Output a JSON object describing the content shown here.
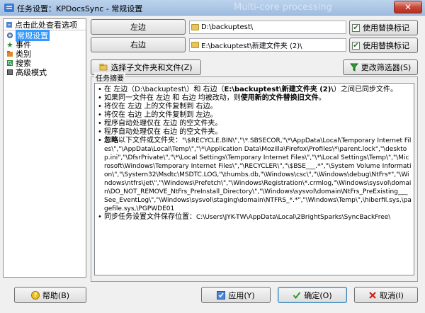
{
  "window": {
    "title": "任务设置：KPDocsSync - 常规设置",
    "background_title": "Multi-core processing",
    "close_label": "✕"
  },
  "sidebar": {
    "header": "点击此处查看选项",
    "items": [
      {
        "label": "常规设置",
        "icon": "gear-icon",
        "selected": true
      },
      {
        "label": "事件",
        "icon": "event-icon",
        "selected": false
      },
      {
        "label": "类别",
        "icon": "category-icon",
        "selected": false
      },
      {
        "label": "搜索",
        "icon": "search-icon",
        "selected": false
      },
      {
        "label": "高级模式",
        "icon": "advanced-icon",
        "selected": false
      }
    ]
  },
  "left": {
    "button": "左边",
    "path": "D:\\backuptest\\",
    "alt_label": "使用替换标记"
  },
  "right": {
    "button": "右边",
    "path": "E:\\backuptest\\新建文件夹 (2)\\",
    "alt_label": "使用替换标记"
  },
  "toolbar": {
    "subfolders_label": "选择子文件夹和文件(Z)",
    "filters_label": "更改筛选器(S)"
  },
  "summary": {
    "title": "任务摘要",
    "lines": {
      "l1a": "在 左边（D:\\backuptest\\）和 右边（",
      "l1b": "E:\\backuptest\\新建文件夹 (2)\\",
      "l1c": "）之间已同步文件。",
      "l2a": "如果同一文件在 左边 和 右边 均被改动，则",
      "l2b": "使用新的文件替换旧文件",
      "l2c": "。",
      "l3": "将仅在 左边 上的文件复制到 右边。",
      "l4": "将仅在 右边 上的文件复制到 左边。",
      "l5": "程序自动处理仅在 左边 的空文件夹。",
      "l6": "程序自动处理仅在 右边 的空文件夹。",
      "l7a": "忽略",
      "l7b": "以下文件或文件夹：",
      "l7c": "\"\\$RECYCLE.BIN\\\",\"\\*.SBSECOR,\"\\*\\AppData\\Local\\Temporary Internet Files\\\",\"\\AppData\\Local\\Temp\\\",\"\\*\\Application Data\\Mozilla\\Firefox\\Profiles\\*\\parent.lock\",\"\\desktop.ini\",\"\\DfsrPrivate\\\",\"\\*\\Local Settings\\Temporary Internet Files\\\",\"\\*\\Local Settings\\Temp\\\",\"\\Microsoft\\Windows\\Temporary Internet Files\\\",\"\\RECYCLER\\\",\"\\$BSE___.*\",\"\\System Volume Information\\\",\"\\System32\\Msdtc\\MSDTC.LOG,\"\\thumbs.db,\"\\Windows\\csc\\\",\"\\Windows\\debug\\NtFrs*\",\"\\Windows\\ntfrs\\jet\\\",\"\\Windows\\Prefetch\\\",\"\\Windows\\Registration\\*.crmlog,\"\\Windows\\sysvol\\domain\\DO_NOT_REMOVE_NtFrs_PreInstall_Directory\\\",\"\\Windows\\sysvol\\domain\\NtFrs_PreExisting___See_EventLog\\\",\"\\Windows\\sysvol\\staging\\domain\\NTFRS_*.*\",\"\\Windows\\Temp\\\",\\hiberfil.sys,\\pagefile.sys,\\PGPWDE01",
      "l8a": "同步任务设置文件保存位置：",
      "l8b": "C:\\Users\\JYK-TW\\AppData\\Local\\2BrightSparks\\SyncBackFree\\"
    }
  },
  "footer": {
    "help": "帮助(B)",
    "apply": "应用(Y)",
    "ok": "确定(O)",
    "cancel": "取消(I)"
  },
  "colors": {
    "selection": "#3399ff",
    "window_bg": "#f0f0f0"
  }
}
